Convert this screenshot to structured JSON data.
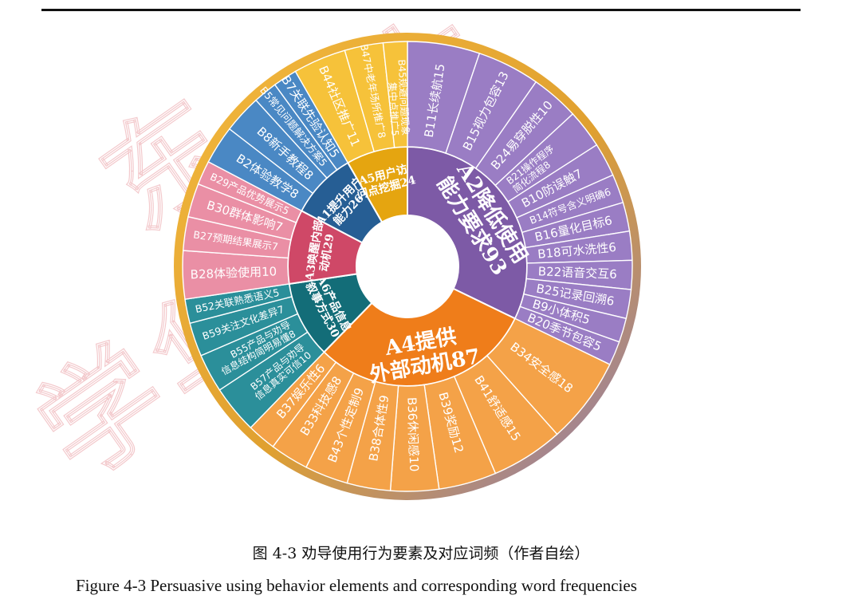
{
  "chart_data": {
    "type": "sunburst",
    "title": "",
    "inner": [
      {
        "label": "A2降低使用能力要求93",
        "lines": [
          "A2降低使用",
          "能力要求93"
        ],
        "value": 93,
        "color": "#7d5aa6",
        "children": [
          {
            "label": "B11长续航15",
            "value": 15
          },
          {
            "label": "B15视力包容13",
            "value": 13
          },
          {
            "label": "B24易穿脱性10",
            "value": 10
          },
          {
            "label": "B21操作程序简化流程8",
            "lines": [
              "B21操作程序",
              "简化流程8"
            ],
            "value": 8
          },
          {
            "label": "B10防误触7",
            "value": 7
          },
          {
            "label": "B14符号含义明确6",
            "value": 6
          },
          {
            "label": "B16量化目标6",
            "value": 6
          },
          {
            "label": "B18可水洗性6",
            "value": 6
          },
          {
            "label": "B22语音交互6",
            "value": 6
          },
          {
            "label": "B25记录回溯6",
            "value": 6
          },
          {
            "label": "B9小体积5",
            "value": 5
          },
          {
            "label": "B20季节包容5",
            "value": 5
          }
        ]
      },
      {
        "label": "A4提供外部动机87",
        "lines": [
          "A4提供",
          "外部动机87"
        ],
        "value": 87,
        "color": "#ef7d1a",
        "children": [
          {
            "label": "B34安全感18",
            "value": 18
          },
          {
            "label": "B41舒适感15",
            "value": 15
          },
          {
            "label": "B39奖励12",
            "value": 12
          },
          {
            "label": "B36休闲感10",
            "value": 10
          },
          {
            "label": "B38合体性9",
            "value": 9
          },
          {
            "label": "B43个性定制9",
            "value": 9
          },
          {
            "label": "B33科技感8",
            "value": 8
          },
          {
            "label": "B37娱乐性6",
            "value": 6
          }
        ]
      },
      {
        "label": "A6产品信息叙事方式30",
        "lines": [
          "A6产品信息",
          "叙事方式30"
        ],
        "value": 30,
        "color": "#136d78",
        "children": [
          {
            "label": "B57产品与劝导信息真实可信10",
            "lines": [
              "B57产品与劝导",
              "信息真实可信10"
            ],
            "value": 10
          },
          {
            "label": "B55产品与劝导信息结构简明易懂8",
            "lines": [
              "B55产品与劝导",
              "信息结构简明易懂8"
            ],
            "value": 8
          },
          {
            "label": "B59关注文化差异7",
            "value": 7
          },
          {
            "label": "B52关联熟悉语义5",
            "value": 5
          }
        ]
      },
      {
        "label": "A3唤醒内部动机29",
        "lines": [
          "A3唤醒内部",
          "动机29"
        ],
        "value": 29,
        "color": "#cf4867",
        "children": [
          {
            "label": "B28体验使用10",
            "value": 10
          },
          {
            "label": "B27预期结果展示7",
            "value": 7
          },
          {
            "label": "B30群体影响7",
            "value": 7
          },
          {
            "label": "B29产品优势展示5",
            "value": 5
          }
        ]
      },
      {
        "label": "A1提升用户能力26",
        "lines": [
          "A1提升用户",
          "能力26"
        ],
        "value": 26,
        "color": "#265e94",
        "children": [
          {
            "label": "B2体验教学8",
            "value": 8
          },
          {
            "label": "B8新手教程8",
            "value": 8
          },
          {
            "label": "B5常见问题解决方案5",
            "value": 5
          },
          {
            "label": "B7关联先验认知5",
            "value": 5
          }
        ]
      },
      {
        "label": "A5用户访问点挖掘24",
        "lines": [
          "A5用户访",
          "问点挖掘24"
        ],
        "value": 24,
        "color": "#e5a510",
        "children": [
          {
            "label": "B44社区推广11",
            "value": 11
          },
          {
            "label": "B47中老年场所推广8",
            "value": 8
          },
          {
            "label": "B45规避问题现象集中点推广5",
            "lines": [
              "B45规避问题现象",
              "集中点推广5"
            ],
            "value": 5
          }
        ]
      }
    ],
    "outer_colors": [
      "#9a7dc4",
      "#f4a248",
      "#2b8f9a",
      "#ea8fa5",
      "#4a88c4",
      "#f6c23a"
    ]
  },
  "watermark": "东华大学",
  "caption_cn": "图 4-3  劝导使用行为要素及对应词频（作者自绘）",
  "caption_en": "Figure 4-3 Persuasive using behavior elements and corresponding word frequencies"
}
